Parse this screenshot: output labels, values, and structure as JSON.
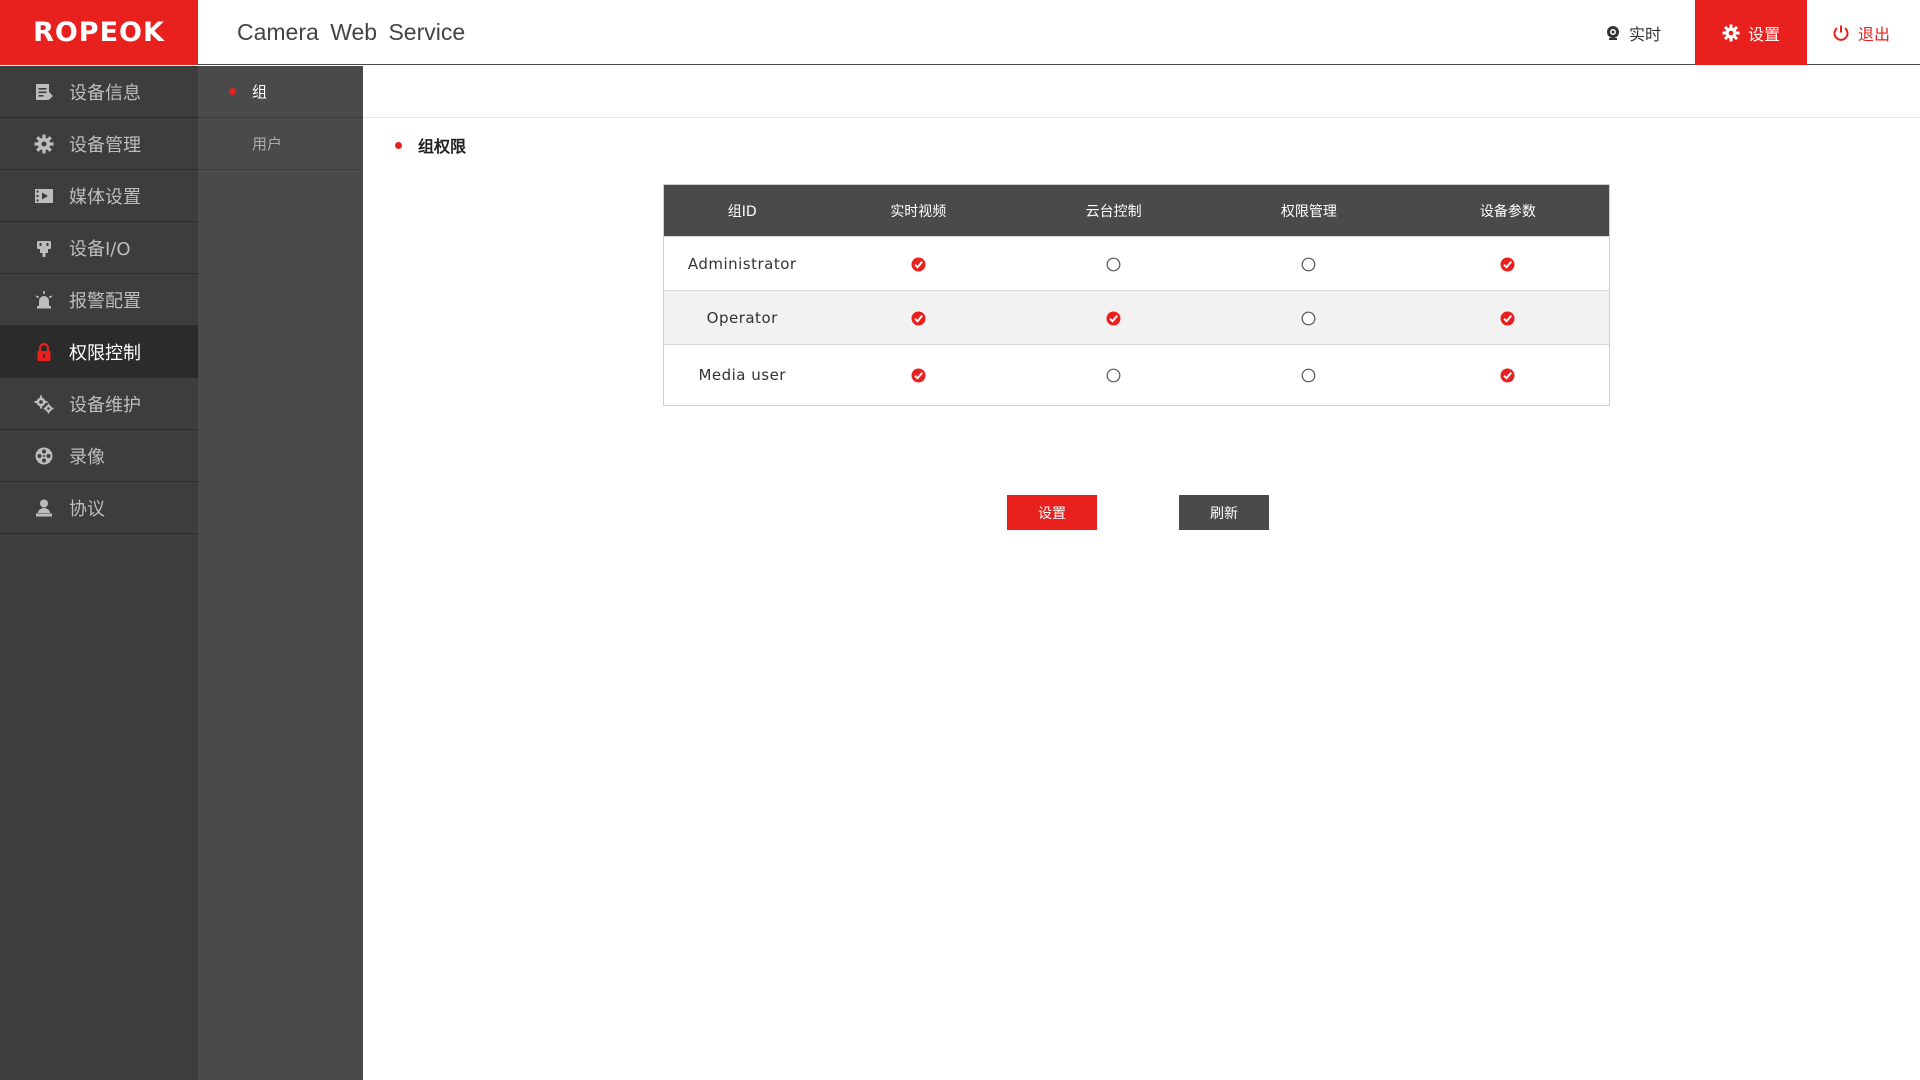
{
  "header": {
    "logo": "ROPEOK",
    "title": "Camera Web Service",
    "nav": {
      "live_label": "实时",
      "settings_label": "设置",
      "logout_label": "退出"
    }
  },
  "sidebar": {
    "items": [
      {
        "label": "设备信息",
        "icon": "document-icon"
      },
      {
        "label": "设备管理",
        "icon": "gear-icon"
      },
      {
        "label": "媒体设置",
        "icon": "film-icon"
      },
      {
        "label": "设备I/O",
        "icon": "plug-icon"
      },
      {
        "label": "报警配置",
        "icon": "alarm-light-icon"
      },
      {
        "label": "权限控制",
        "icon": "lock-icon",
        "active": true
      },
      {
        "label": "设备维护",
        "icon": "gears-icon"
      },
      {
        "label": "录像",
        "icon": "film-reel-icon"
      },
      {
        "label": "协议",
        "icon": "user-stand-icon"
      }
    ]
  },
  "subnav": {
    "items": [
      {
        "label": "组",
        "active": true
      },
      {
        "label": "用户"
      }
    ]
  },
  "main": {
    "section_title": "组权限",
    "table": {
      "headers": [
        "组ID",
        "实时视频",
        "云台控制",
        "权限管理",
        "设备参数"
      ],
      "rows": [
        {
          "group": "Administrator",
          "perms": [
            true,
            false,
            false,
            true
          ]
        },
        {
          "group": "Operator",
          "perms": [
            true,
            true,
            false,
            true
          ]
        },
        {
          "group": "Media user",
          "perms": [
            true,
            false,
            false,
            true
          ]
        }
      ]
    },
    "buttons": {
      "set_label": "设置",
      "refresh_label": "刷新"
    }
  },
  "colors": {
    "accent": "#e8201e",
    "sidebar_bg": "#3d3d3d",
    "subnav_bg": "#4a4a4a"
  }
}
